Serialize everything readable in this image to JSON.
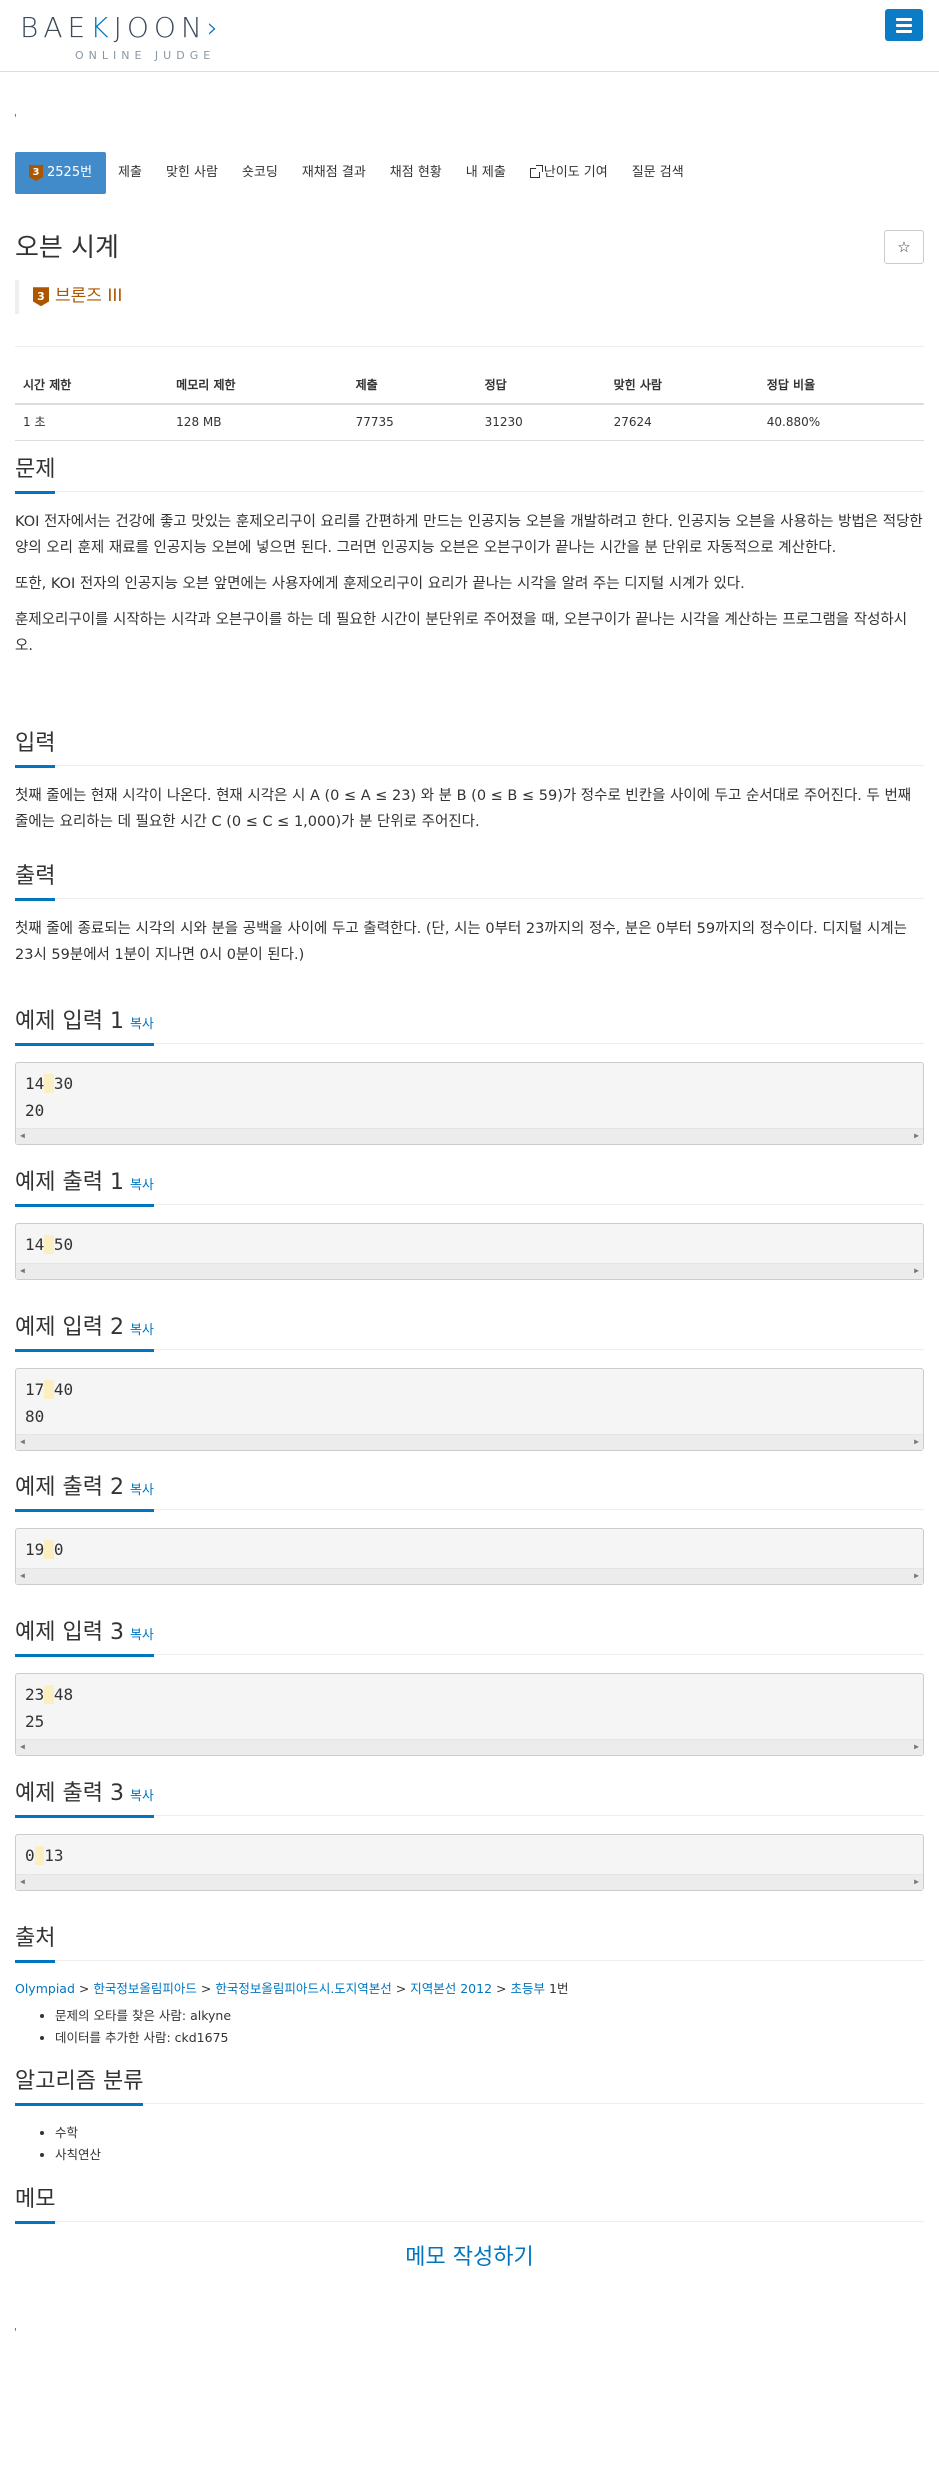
{
  "header": {
    "logo_main_left": "BAE",
    "logo_main_accent": "K",
    "logo_main_right": "JOON",
    "logo_main_chevron": "›",
    "logo_sub": "ONLINE JUDGE",
    "menu_icon": "hamburger-menu-icon"
  },
  "small_mark": "'",
  "tabs": [
    {
      "label": "2525번",
      "tier": "3"
    },
    {
      "label": "제출"
    },
    {
      "label": "맞힌 사람"
    },
    {
      "label": "숏코딩"
    },
    {
      "label": "재채점 결과"
    },
    {
      "label": "채점 현황"
    },
    {
      "label": "내 제출"
    },
    {
      "label": "난이도 기여"
    },
    {
      "label": "질문 검색"
    }
  ],
  "problem": {
    "title": "오븐 시계",
    "star": "☆",
    "tier_num": "3",
    "tier_label": "브론즈 III"
  },
  "info_table": {
    "headers": [
      "시간 제한",
      "메모리 제한",
      "제출",
      "정답",
      "맞힌 사람",
      "정답 비율"
    ],
    "values": [
      "1 초",
      "128 MB",
      "77735",
      "31230",
      "27624",
      "40.880%"
    ]
  },
  "sections": {
    "problem_head": "문제",
    "problem_p1": "KOI 전자에서는 건강에 좋고 맛있는 훈제오리구이 요리를 간편하게 만드는 인공지능 오븐을 개발하려고 한다. 인공지능 오븐을 사용하는 방법은 적당한 양의 오리 훈제 재료를 인공지능 오븐에 넣으면 된다. 그러면 인공지능 오븐은 오븐구이가 끝나는 시간을 분 단위로 자동적으로 계산한다.",
    "problem_p2": "또한, KOI 전자의 인공지능 오븐 앞면에는 사용자에게 훈제오리구이 요리가 끝나는 시각을 알려 주는 디지털 시계가 있다.",
    "problem_p3": "훈제오리구이를 시작하는 시각과 오븐구이를 하는 데 필요한 시간이 분단위로 주어졌을 때, 오븐구이가 끝나는 시각을 계산하는 프로그램을 작성하시오.",
    "input_head": "입력",
    "input_p": "첫째 줄에는 현재 시각이 나온다. 현재 시각은 시 A (0 ≤ A ≤ 23) 와 분 B (0 ≤ B ≤ 59)가 정수로 빈칸을 사이에 두고 순서대로 주어진다. 두 번째 줄에는 요리하는 데 필요한 시간 C (0 ≤ C ≤ 1,000)가 분 단위로 주어진다.",
    "output_head": "출력",
    "output_p": "첫째 줄에 종료되는 시각의 시와 분을 공백을 사이에 두고 출력한다. (단, 시는 0부터 23까지의 정수, 분은 0부터 59까지의 정수이다. 디지털 시계는 23시 59분에서 1분이 지나면 0시 0분이 된다.)"
  },
  "copy_label": "복사",
  "examples": [
    {
      "title": "예제 입력 1",
      "l1a": "14",
      "l1b": "30",
      "l2": "20"
    },
    {
      "title": "예제 출력 1",
      "l1a": "14",
      "l1b": "50"
    },
    {
      "title": "예제 입력 2",
      "l1a": "17",
      "l1b": "40",
      "l2": "80"
    },
    {
      "title": "예제 출력 2",
      "l1a": "19",
      "l1b": "0"
    },
    {
      "title": "예제 입력 3",
      "l1a": "23",
      "l1b": "48",
      "l2": "25"
    },
    {
      "title": "예제 출력 3",
      "l1a": "0",
      "l1b": "13"
    }
  ],
  "source": {
    "head": "출처",
    "breadcrumb": [
      "Olympiad",
      "한국정보올림피아드",
      "한국정보올림피아드시.도지역본선",
      "지역본선 2012",
      "초등부"
    ],
    "sep": ">",
    "suffix": "1번",
    "contrib1": "문제의 오타를 찾은 사람: alkyne",
    "contrib2": "데이터를 추가한 사람: ckd1675"
  },
  "algo": {
    "head": "알고리즘 분류",
    "items": [
      "수학",
      "사칙연산"
    ]
  },
  "memo": {
    "head": "메모",
    "button": "메모 작성하기"
  }
}
